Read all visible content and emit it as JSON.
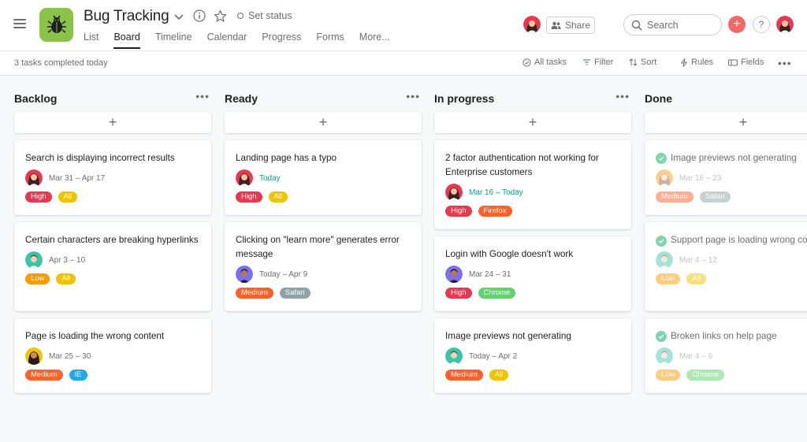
{
  "header": {
    "title": "Bug Tracking",
    "set_status": "Set status",
    "tabs": [
      "List",
      "Board",
      "Timeline",
      "Calendar",
      "Progress",
      "Forms",
      "More..."
    ],
    "active_tab": "Board",
    "share_label": "Share",
    "search_placeholder": "Search",
    "help_label": "?",
    "plus_label": "+"
  },
  "subbar": {
    "completed": "3 tasks completed today",
    "all_tasks": "All tasks",
    "filter": "Filter",
    "sort": "Sort",
    "rules": "Rules",
    "fields": "Fields",
    "more": "•••"
  },
  "colors": {
    "brand_green": "#8bc34a",
    "accent_coral": "#f06a6a",
    "done_check": "#7fd4b2",
    "date_today": "#14a37f"
  },
  "tag_colors": {
    "High": "#e8384f",
    "All": "#eec300",
    "Low": "#fd9a00",
    "Medium": "#fd612c",
    "IE": "#20aaea",
    "Safari": "#8da3a6",
    "Firefox": "#fd612c",
    "Chrome": "#62d26f"
  },
  "board": {
    "columns": [
      {
        "title": "Backlog",
        "more": "•••",
        "add": "+",
        "cards": [
          {
            "title": "Search is displaying incorrect results",
            "date": "Mar 31 – Apr 17",
            "date_green": false,
            "avatar": "woman-red",
            "tags": [
              "High",
              "All"
            ],
            "done": false
          },
          {
            "title": "Certain characters are breaking hyperlinks",
            "date": "Apr 3 – 10",
            "date_green": false,
            "avatar": "man-teal",
            "tags": [
              "Low",
              "All"
            ],
            "done": false
          },
          {
            "title": "Page is loading the wrong content",
            "date": "Mar 25 – 30",
            "date_green": false,
            "avatar": "woman-yellow",
            "tags": [
              "Medium",
              "IE"
            ],
            "done": false
          }
        ]
      },
      {
        "title": "Ready",
        "more": "•••",
        "add": "+",
        "cards": [
          {
            "title": "Landing page has a typo",
            "date": "Today",
            "date_green": true,
            "avatar": "woman-red",
            "tags": [
              "High",
              "All"
            ],
            "done": false
          },
          {
            "title": "Clicking on \"learn more\" generates error message",
            "date": "Today – Apr 9",
            "date_green": false,
            "avatar": "man-purple",
            "tags": [
              "Medium",
              "Safari"
            ],
            "done": false
          }
        ]
      },
      {
        "title": "In progress",
        "more": "•••",
        "add": "+",
        "cards": [
          {
            "title": "2 factor authentication not working for Enterprise customers",
            "date": "Mar 16 – Today",
            "date_green": true,
            "avatar": "woman-red",
            "tags": [
              "High",
              "Firefox"
            ],
            "done": false
          },
          {
            "title": "Login with Google doesn't work",
            "date": "Mar 24 – 31",
            "date_green": false,
            "avatar": "man-purple",
            "tags": [
              "High",
              "Chrome"
            ],
            "done": false
          },
          {
            "title": "Image previews not generating",
            "date": "Today – Apr 2",
            "date_green": false,
            "avatar": "man-teal",
            "tags": [
              "Medium",
              "All"
            ],
            "done": false
          }
        ]
      },
      {
        "title": "Done",
        "more": "",
        "add": "+",
        "cards": [
          {
            "title": "Image previews not generating",
            "date": "Mar 16 – 23",
            "date_green": false,
            "avatar": "woman-orange",
            "tags": [
              "Medium",
              "Safari"
            ],
            "done": true
          },
          {
            "title": "Support page is loading wrong content",
            "date": "Mar 4 – 12",
            "date_green": false,
            "avatar": "man-teal",
            "tags": [
              "Low",
              "All"
            ],
            "done": true
          },
          {
            "title": "Broken links on help page",
            "date": "Mar 4 – 6",
            "date_green": false,
            "avatar": "man-teal",
            "tags": [
              "Low",
              "Chrome"
            ],
            "done": true
          }
        ]
      }
    ]
  }
}
